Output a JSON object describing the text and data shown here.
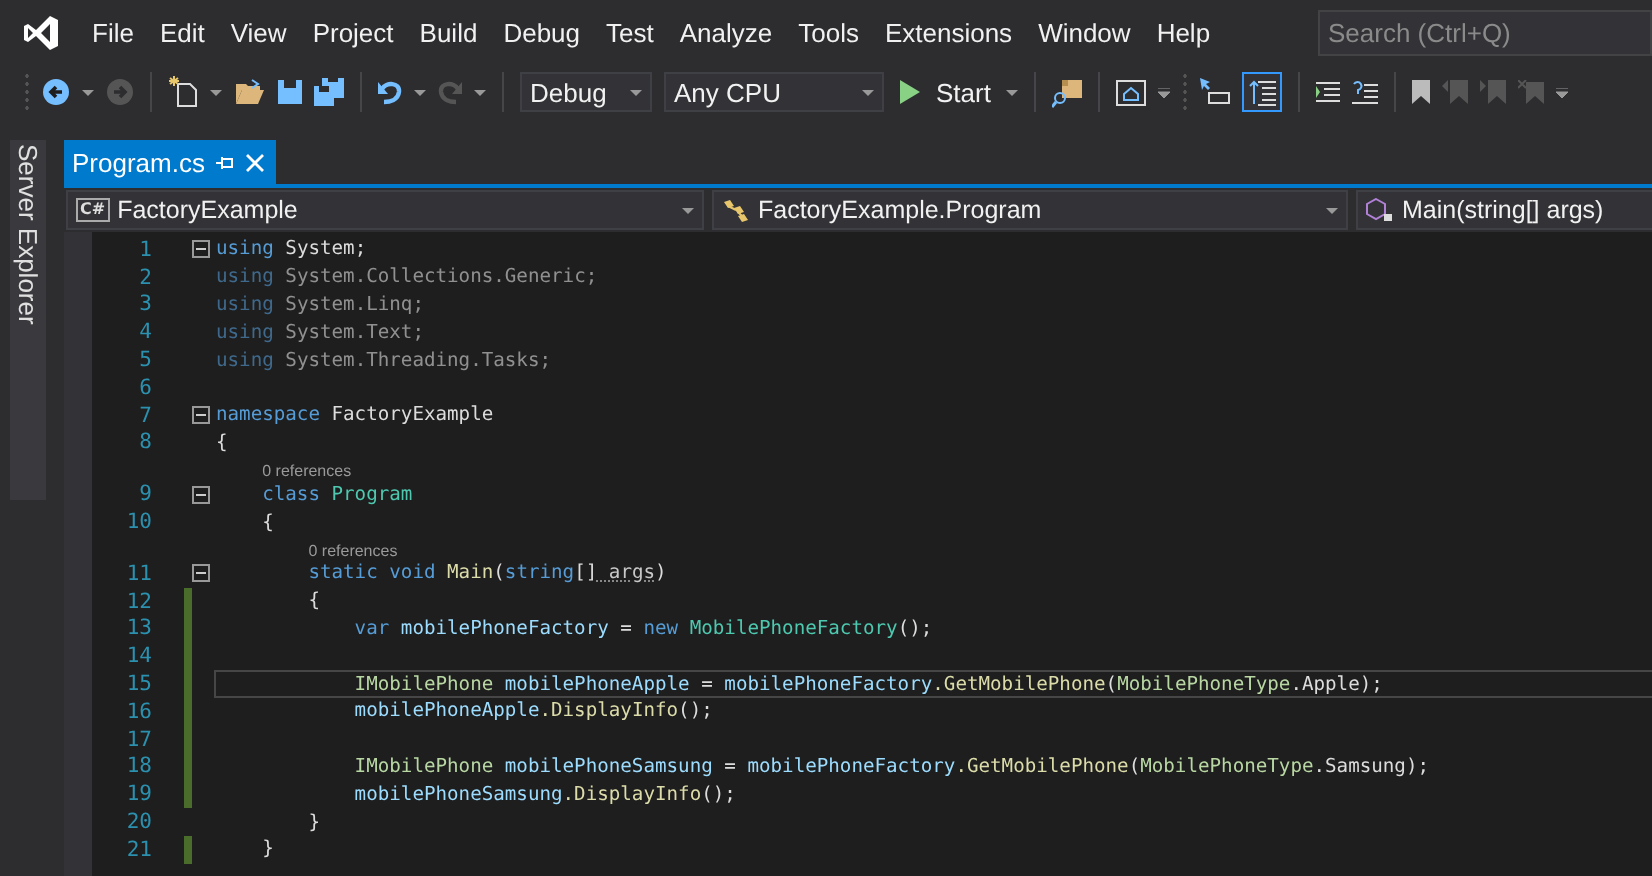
{
  "menu": {
    "items": [
      "File",
      "Edit",
      "View",
      "Project",
      "Build",
      "Debug",
      "Test",
      "Analyze",
      "Tools",
      "Extensions",
      "Window",
      "Help"
    ],
    "search": {
      "placeholder": "Search (Ctrl+Q)"
    }
  },
  "toolbar": {
    "configuration": "Debug",
    "platform": "Any CPU",
    "start": "Start",
    "toggle_on": true
  },
  "side_tab": {
    "label": "Server Explorer"
  },
  "tabs": [
    {
      "label": "Program.cs",
      "selected": true
    }
  ],
  "navigation": {
    "project": {
      "badge": "C#",
      "label": "FactoryExample"
    },
    "type": "FactoryExample.Program",
    "member": "Main(string[] args)"
  },
  "lines": [
    {
      "number": "1",
      "foldable": true,
      "changed": false,
      "faded": false,
      "current": false,
      "tokens": [
        {
          "kind": "keyword",
          "text": "using"
        },
        {
          "kind": "plain",
          "text": " System;"
        }
      ]
    },
    {
      "number": "2",
      "foldable": false,
      "changed": false,
      "faded": true,
      "current": false,
      "tokens": [
        {
          "kind": "keyword",
          "text": "using"
        },
        {
          "kind": "plain",
          "text": " System.Collections.Generic;"
        }
      ]
    },
    {
      "number": "3",
      "foldable": false,
      "changed": false,
      "faded": true,
      "current": false,
      "tokens": [
        {
          "kind": "keyword",
          "text": "using"
        },
        {
          "kind": "plain",
          "text": " System.Linq;"
        }
      ]
    },
    {
      "number": "4",
      "foldable": false,
      "changed": false,
      "faded": true,
      "current": false,
      "tokens": [
        {
          "kind": "keyword",
          "text": "using"
        },
        {
          "kind": "plain",
          "text": " System.Text;"
        }
      ]
    },
    {
      "number": "5",
      "foldable": false,
      "changed": false,
      "faded": true,
      "current": false,
      "tokens": [
        {
          "kind": "keyword",
          "text": "using"
        },
        {
          "kind": "plain",
          "text": " System.Threading.Tasks;"
        }
      ]
    },
    {
      "number": "6",
      "foldable": false,
      "changed": false,
      "faded": false,
      "current": false
    },
    {
      "number": "7",
      "foldable": true,
      "changed": false,
      "faded": false,
      "current": false,
      "tokens": [
        {
          "kind": "keyword",
          "text": "namespace"
        },
        {
          "kind": "plain",
          "text": " FactoryExample"
        }
      ]
    },
    {
      "number": "8",
      "foldable": false,
      "changed": false,
      "faded": false,
      "current": false,
      "tokens": [
        {
          "kind": "plain",
          "text": "{"
        }
      ]
    },
    {
      "number": "9",
      "foldable": true,
      "changed": false,
      "faded": false,
      "current": false,
      "lens": "0 references",
      "tokens": [
        {
          "kind": "keyword",
          "text": "    class"
        },
        {
          "kind": "type",
          "text": " Program"
        }
      ]
    },
    {
      "number": "10",
      "foldable": false,
      "changed": false,
      "faded": false,
      "current": false,
      "tokens": [
        {
          "kind": "plain",
          "text": "    {"
        }
      ]
    },
    {
      "number": "11",
      "foldable": true,
      "changed": false,
      "faded": false,
      "current": false,
      "lens": "0 references",
      "tokens": [
        {
          "kind": "keyword",
          "text": "        static void"
        },
        {
          "kind": "method",
          "text": " Main"
        },
        {
          "kind": "plain",
          "text": "("
        },
        {
          "kind": "keyword",
          "text": "string"
        },
        {
          "kind": "plain",
          "text": "[]"
        },
        {
          "kind": "unused",
          "text": " args"
        },
        {
          "kind": "plain",
          "text": ")"
        }
      ]
    },
    {
      "number": "12",
      "foldable": false,
      "changed": true,
      "faded": false,
      "current": false,
      "tokens": [
        {
          "kind": "plain",
          "text": "        {"
        }
      ]
    },
    {
      "number": "13",
      "foldable": false,
      "changed": true,
      "faded": false,
      "current": false,
      "tokens": [
        {
          "kind": "keyword",
          "text": "            var"
        },
        {
          "kind": "local",
          "text": " mobilePhoneFactory"
        },
        {
          "kind": "plain",
          "text": " ="
        },
        {
          "kind": "keyword",
          "text": " new"
        },
        {
          "kind": "type",
          "text": " MobilePhoneFactory"
        },
        {
          "kind": "plain",
          "text": "();"
        }
      ]
    },
    {
      "number": "14",
      "foldable": false,
      "changed": true,
      "faded": false,
      "current": false
    },
    {
      "number": "15",
      "foldable": false,
      "changed": true,
      "faded": false,
      "current": true,
      "tokens": [
        {
          "kind": "interface",
          "text": "            IMobilePhone"
        },
        {
          "kind": "local",
          "text": " mobilePhoneApple"
        },
        {
          "kind": "plain",
          "text": " ="
        },
        {
          "kind": "local",
          "text": " mobilePhoneFactory"
        },
        {
          "kind": "method",
          "text": ".GetMobilePhone"
        },
        {
          "kind": "plain",
          "text": "("
        },
        {
          "kind": "enum",
          "text": "MobilePhoneType"
        },
        {
          "kind": "plain",
          "text": ".Apple);"
        }
      ]
    },
    {
      "number": "16",
      "foldable": false,
      "changed": true,
      "faded": false,
      "current": false,
      "tokens": [
        {
          "kind": "local",
          "text": "            mobilePhoneApple"
        },
        {
          "kind": "method",
          "text": ".DisplayInfo"
        },
        {
          "kind": "plain",
          "text": "();"
        }
      ]
    },
    {
      "number": "17",
      "foldable": false,
      "changed": true,
      "faded": false,
      "current": false
    },
    {
      "number": "18",
      "foldable": false,
      "changed": true,
      "faded": false,
      "current": false,
      "tokens": [
        {
          "kind": "interface",
          "text": "            IMobilePhone"
        },
        {
          "kind": "local",
          "text": " mobilePhoneSamsung"
        },
        {
          "kind": "plain",
          "text": " ="
        },
        {
          "kind": "local",
          "text": " mobilePhoneFactory"
        },
        {
          "kind": "method",
          "text": ".GetMobilePhone"
        },
        {
          "kind": "plain",
          "text": "("
        },
        {
          "kind": "enum",
          "text": "MobilePhoneType"
        },
        {
          "kind": "plain",
          "text": ".Samsung);"
        }
      ]
    },
    {
      "number": "19",
      "foldable": false,
      "changed": true,
      "faded": false,
      "current": false,
      "tokens": [
        {
          "kind": "local",
          "text": "            mobilePhoneSamsung"
        },
        {
          "kind": "method",
          "text": ".DisplayInfo"
        },
        {
          "kind": "plain",
          "text": "();"
        }
      ]
    },
    {
      "number": "20",
      "foldable": false,
      "changed": false,
      "faded": false,
      "current": false,
      "tokens": [
        {
          "kind": "plain",
          "text": "        }"
        }
      ]
    },
    {
      "number": "21",
      "foldable": false,
      "changed": true,
      "faded": false,
      "current": false,
      "tokens": [
        {
          "kind": "plain",
          "text": "    }"
        }
      ]
    }
  ]
}
